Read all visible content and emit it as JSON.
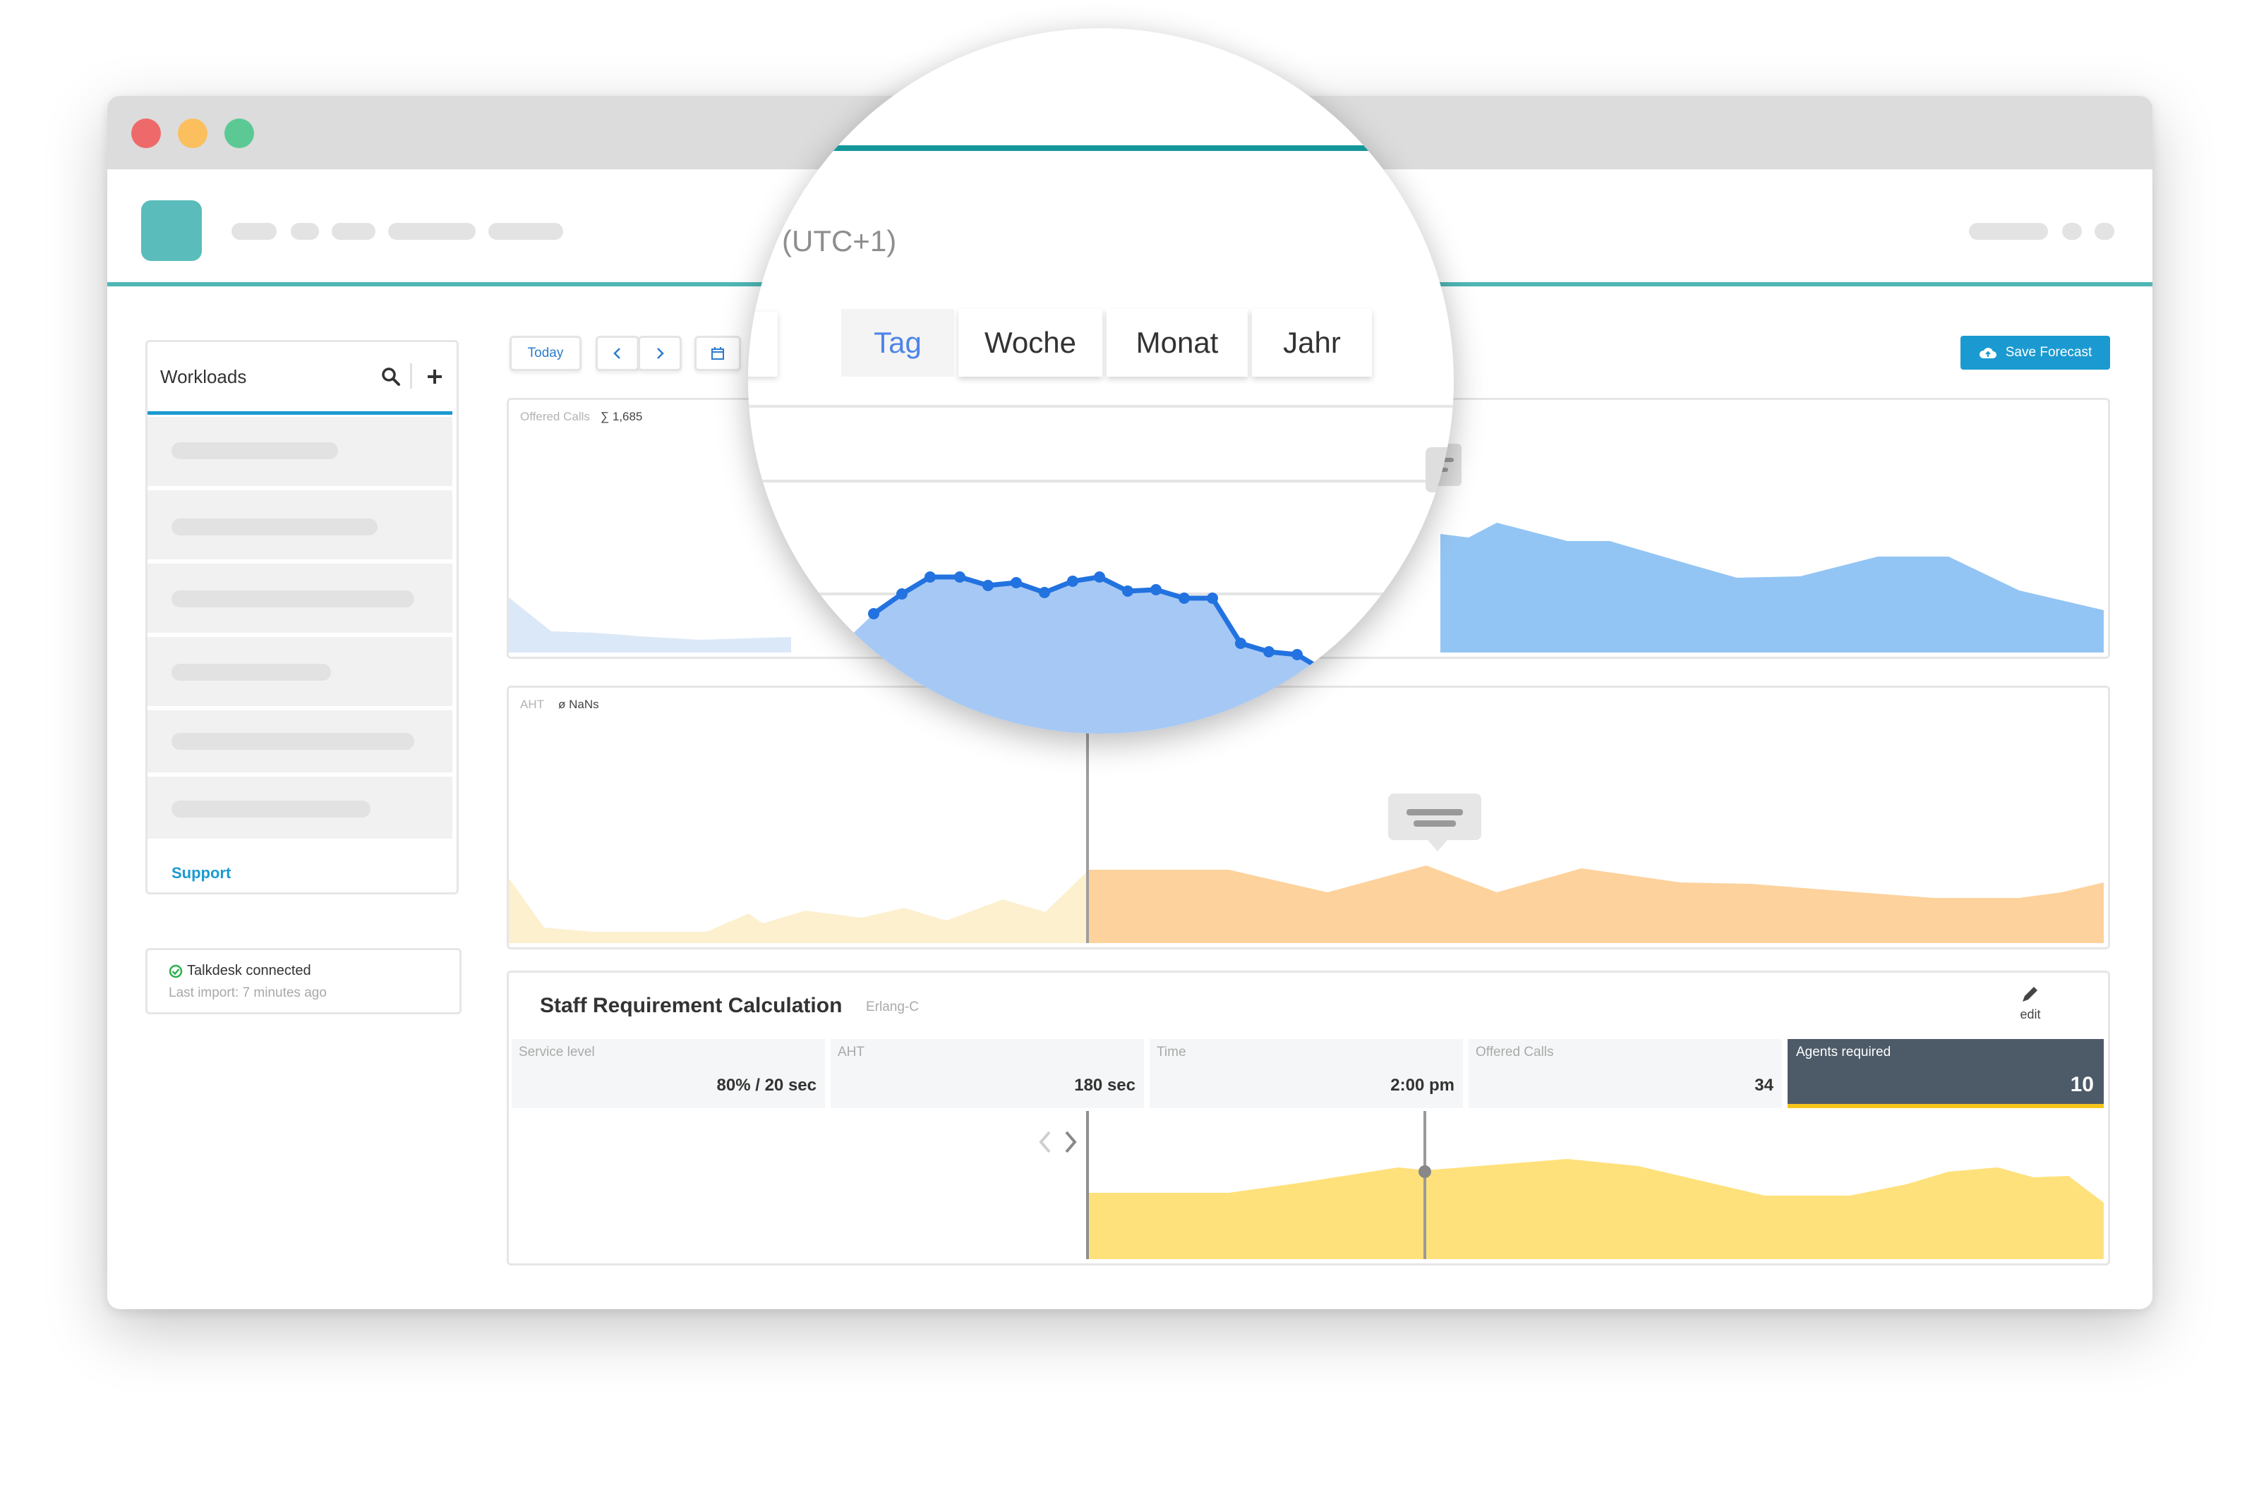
{
  "sidebar": {
    "title": "Workloads",
    "support_label": "Support",
    "status": {
      "connected": "Talkdesk connected",
      "last_import": "Last import: 7 minutes ago"
    }
  },
  "toolbar": {
    "today_label": "Today",
    "save_label": "Save Forecast",
    "timezone_text": "(UTC+1)",
    "view_tabs": [
      "Tag",
      "Woche",
      "Monat",
      "Jahr"
    ],
    "active_view": "Tag"
  },
  "charts": {
    "offered_calls": {
      "label": "Offered Calls",
      "total": "∑ 1,685"
    },
    "aht": {
      "label": "AHT",
      "avg": "ø NaNs"
    }
  },
  "staff": {
    "title": "Staff Requirement Calculation",
    "method": "Erlang-C",
    "edit_label": "edit",
    "cells": [
      {
        "title": "Service level",
        "value": "80% / 20 sec"
      },
      {
        "title": "AHT",
        "value": "180 sec"
      },
      {
        "title": "Time",
        "value": "2:00 pm"
      },
      {
        "title": "Offered Calls",
        "value": "34"
      },
      {
        "title": "Agents required",
        "value": "10"
      }
    ]
  },
  "colors": {
    "accent": "#4fb7b5",
    "primary": "#1b9ad1",
    "calls_fill": "#93c5f4",
    "calls_fill_light": "#dbe8f7",
    "line_blue": "#2272e0",
    "aht_fill": "#fdd29c",
    "aht_fill_light": "#fcf0cf",
    "staff_fill": "#ffe17b",
    "agents_bg": "#4d5a68"
  },
  "icons": {
    "search": "search-icon",
    "add": "plus-icon",
    "prev": "chevron-left-icon",
    "next": "chevron-right-icon",
    "calendar": "calendar-icon",
    "cloud": "cloud-upload-icon",
    "edit": "pencil-icon",
    "check": "check-circle-icon",
    "comment": "comment-icon"
  }
}
